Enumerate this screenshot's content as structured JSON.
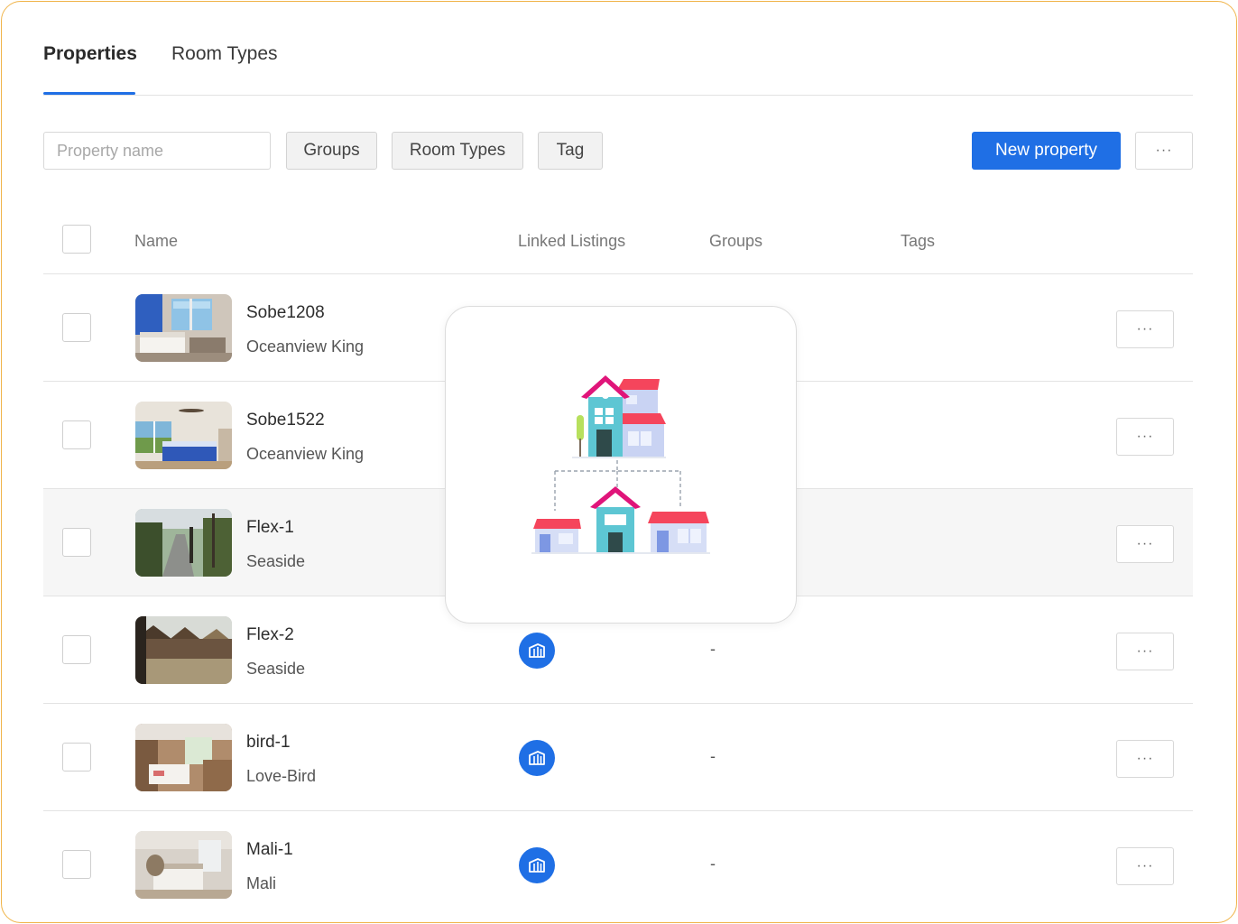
{
  "tabs": [
    {
      "label": "Properties",
      "active": true
    },
    {
      "label": "Room Types",
      "active": false
    }
  ],
  "toolbar": {
    "search_placeholder": "Property name",
    "groups_label": "Groups",
    "room_types_label": "Room Types",
    "tag_label": "Tag",
    "new_property_label": "New property",
    "more_label": "···"
  },
  "table": {
    "columns": [
      "Name",
      "Linked Listings",
      "Groups",
      "Tags"
    ],
    "rows": [
      {
        "name": "Sobe1208",
        "room_type": "Oceanview King",
        "groups": "",
        "more": "···"
      },
      {
        "name": "Sobe1522",
        "room_type": "Oceanview King",
        "groups": "",
        "more": "···"
      },
      {
        "name": "Flex-1",
        "room_type": "Seaside",
        "groups": "",
        "more": "···"
      },
      {
        "name": "Flex-2",
        "room_type": "Seaside",
        "groups": "-",
        "more": "···"
      },
      {
        "name": "bird-1",
        "room_type": "Love-Bird",
        "groups": "-",
        "more": "···"
      },
      {
        "name": "Mali-1",
        "room_type": "Mali",
        "groups": "-",
        "more": "···"
      }
    ]
  },
  "colors": {
    "accent": "#1f6fe5",
    "frame_border": "#f0b449",
    "roof_red": "#f5455c",
    "roof_magenta": "#e0157a",
    "house_teal": "#5dc6d3",
    "house_lilac": "#c9d3f3"
  },
  "icons": {
    "linked_listing": "building-icon",
    "overlay": "property-hierarchy-icon"
  }
}
